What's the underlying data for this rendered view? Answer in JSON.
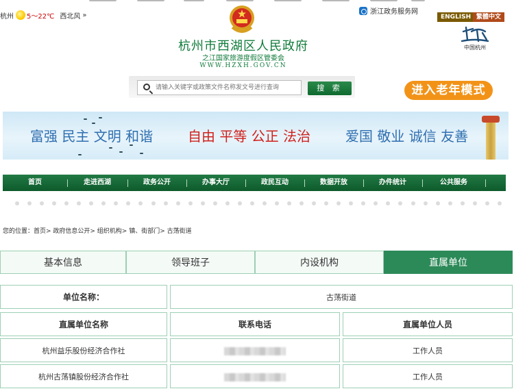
{
  "header": {
    "weather": {
      "city": "杭州",
      "temp": "5～22℃",
      "wind": "西北风",
      "more": "»"
    },
    "gov_service_link": "浙江政务服务网",
    "lang": [
      {
        "label": "ENGLISH",
        "color": "#7a5a00"
      },
      {
        "label": "繁體中文",
        "color": "#b04a1a"
      }
    ],
    "title": "杭州市西湖区人民政府",
    "subtitle": "之江国家旅游度假区管委会",
    "url": "WWW.HZXH.GOV.CN",
    "city_logo_text": "中国杭州"
  },
  "search": {
    "placeholder": "请输入关键字或政策文件名称发文号进行查询",
    "button": "搜 索"
  },
  "elder_mode": "进入老年模式",
  "banner": {
    "slogans": [
      {
        "text": "富强 民主 文明 和谐",
        "color": "#2f6fb0"
      },
      {
        "text": "自由 平等 公正 法治",
        "color": "#d0201c"
      },
      {
        "text": "爱国 敬业 诚信 友善",
        "color": "#2f6fb0"
      }
    ]
  },
  "nav": [
    "首页",
    "走进西湖",
    "政务公开",
    "办事大厅",
    "政民互动",
    "数据开放",
    "办件统计",
    "公共服务"
  ],
  "breadcrumb": "您的位置：首页> 政府信息公开> 组织机构> 镇、街部门> 古荡街道",
  "tabs": [
    {
      "label": "基本信息",
      "active": false
    },
    {
      "label": "领导班子",
      "active": false
    },
    {
      "label": "内设机构",
      "active": false
    },
    {
      "label": "直属单位",
      "active": true
    }
  ],
  "unit": {
    "label": "单位名称：",
    "value": "古荡街道"
  },
  "table": {
    "headers": [
      "直属单位名称",
      "联系电话",
      "直属单位人员"
    ],
    "rows": [
      {
        "name": "杭州益乐股份经济合作社",
        "phone": "",
        "staff": "工作人员"
      },
      {
        "name": "杭州古荡镇股份经济合作社",
        "phone": "",
        "staff": "工作人员"
      }
    ]
  }
}
